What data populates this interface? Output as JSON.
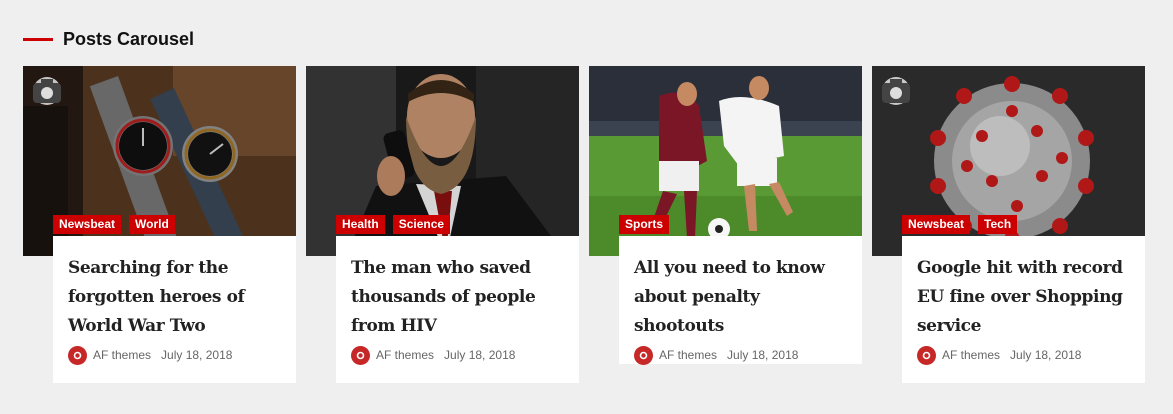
{
  "section": {
    "title": "Posts Carousel",
    "accent": "#cc0000"
  },
  "posts": [
    {
      "image": "watches-photo",
      "has_camera_icon": true,
      "categories": [
        "Newsbeat",
        "World"
      ],
      "title": "Searching for the forgotten heroes of World War Two",
      "author": "AF themes",
      "date": "July 18, 2018"
    },
    {
      "image": "bearded-man-phone-photo",
      "has_camera_icon": false,
      "categories": [
        "Health",
        "Science"
      ],
      "title": "The man who saved thousands of people from HIV",
      "author": "AF themes",
      "date": "July 18, 2018"
    },
    {
      "image": "soccer-players-photo",
      "has_camera_icon": false,
      "categories": [
        "Sports"
      ],
      "title": "All you need to know about penalty shootouts",
      "author": "AF themes",
      "date": "July 18, 2018"
    },
    {
      "image": "coronavirus-photo",
      "has_camera_icon": true,
      "categories": [
        "Newsbeat",
        "Tech"
      ],
      "title": "Google hit with record EU fine over Shopping service",
      "author": "AF themes",
      "date": "July 18, 2018"
    }
  ]
}
